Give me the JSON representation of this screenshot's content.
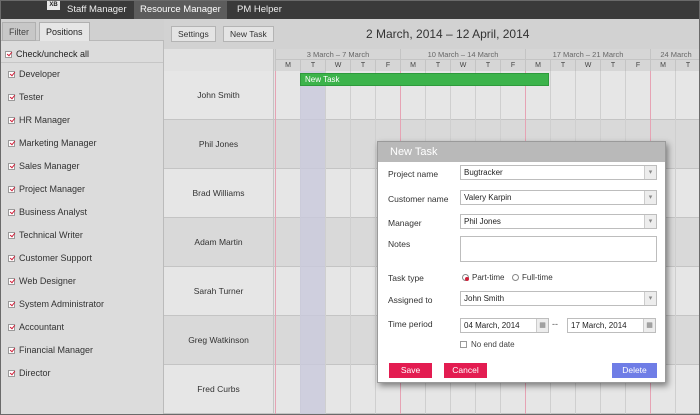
{
  "app": {
    "logo": "XB"
  },
  "top_tabs": [
    "Staff Manager",
    "Resource Manager",
    "PM Helper"
  ],
  "sidebar": {
    "tabs": [
      "Filter",
      "Positions"
    ],
    "check_all": "Check/uncheck all",
    "positions": [
      "Developer",
      "Tester",
      "HR Manager",
      "Marketing Manager",
      "Sales Manager",
      "Project Manager",
      "Business Analyst",
      "Technical Writer",
      "Customer Support",
      "Web Designer",
      "System Administrator",
      "Accountant",
      "Financial Manager",
      "Director"
    ]
  },
  "toolbar": {
    "settings": "Settings",
    "new_task": "New Task",
    "date_range": "2 March, 2014 – 12 April, 2014"
  },
  "timeline": {
    "weeks": [
      "3 March – 7 March",
      "10 March – 14 March",
      "17 March – 21 March",
      "24 March"
    ],
    "day_letters": [
      "M",
      "T",
      "W",
      "T",
      "F",
      "M",
      "T",
      "W",
      "T",
      "F",
      "M",
      "T",
      "W",
      "T",
      "F",
      "M",
      "T"
    ]
  },
  "staff": [
    "John Smith",
    "Phil Jones",
    "Brad Williams",
    "Adam Martin",
    "Sarah Turner",
    "Greg Watkinson",
    "Fred Curbs"
  ],
  "task_bar": {
    "label": "New Task",
    "color": "#3cb34b"
  },
  "dialog": {
    "title": "New Task",
    "labels": {
      "project": "Project name",
      "customer": "Customer name",
      "manager": "Manager",
      "notes": "Notes",
      "task_type": "Task type",
      "assigned": "Assigned to",
      "time_period": "Time period"
    },
    "values": {
      "project": "Bugtracker",
      "customer": "Valery Karpin",
      "manager": "Phil Jones",
      "assigned": "John Smith",
      "start": "04 March, 2014",
      "end": "17 March, 2014"
    },
    "task_types": [
      "Part-time",
      "Full-time"
    ],
    "selected_task_type": "Part-time",
    "no_end_date": "No end date",
    "dash": "--",
    "buttons": {
      "save": "Save",
      "cancel": "Cancel",
      "delete": "Delete"
    }
  },
  "colors": {
    "accent": "#e31c51",
    "delete": "#6f7de6",
    "checkmark": "#d0203a"
  }
}
